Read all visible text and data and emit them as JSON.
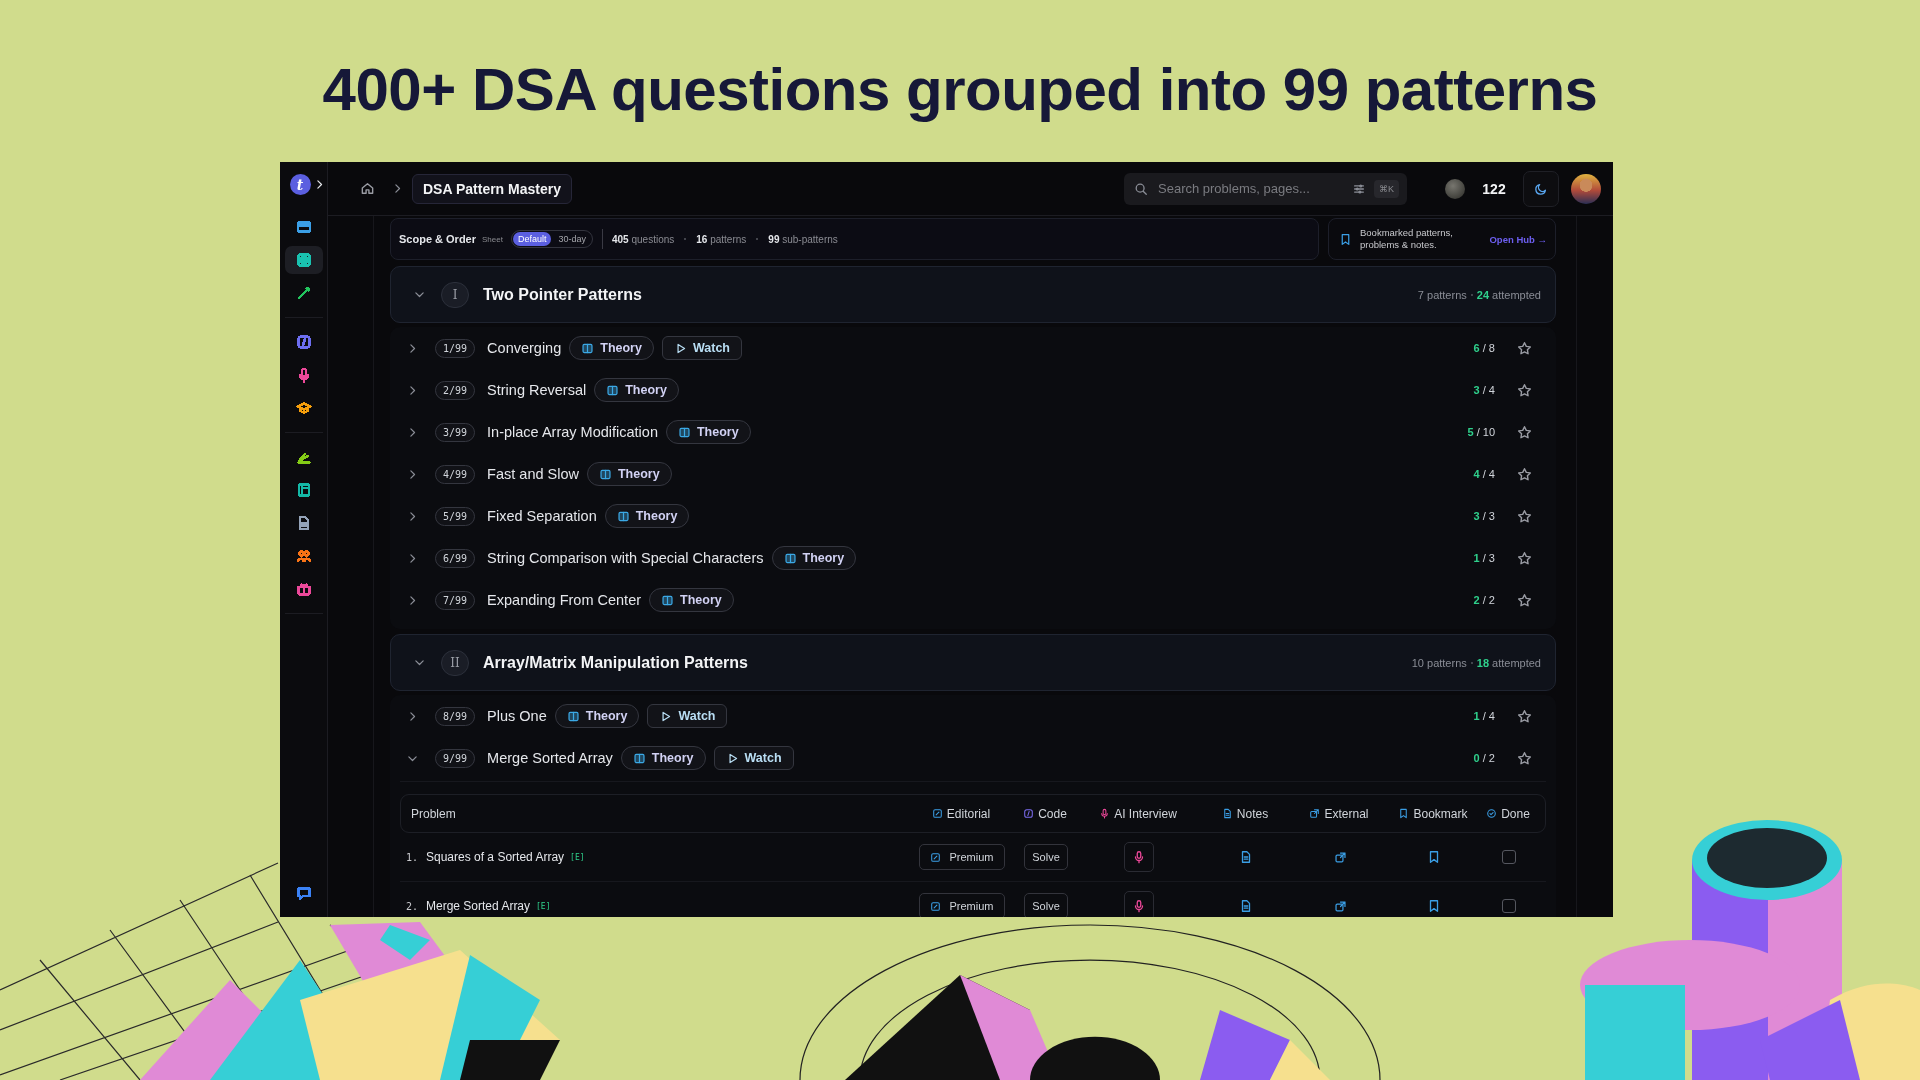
{
  "headline": "400+ DSA questions grouped into 99 patterns",
  "sidebar": {
    "logo": "t",
    "sections": [
      {
        "items": [
          {
            "kind": "card",
            "color": "#3b9fe6",
            "selected": false
          },
          {
            "kind": "grid",
            "color": "#19c2b0",
            "selected": true
          },
          {
            "kind": "pen",
            "color": "#22c55e",
            "selected": false
          }
        ]
      },
      {
        "items": [
          {
            "kind": "code",
            "color": "#6d6ef0",
            "selected": false
          },
          {
            "kind": "mic",
            "color": "#ec4899",
            "selected": false
          },
          {
            "kind": "cap",
            "color": "#f59e0b",
            "selected": false
          }
        ]
      },
      {
        "items": [
          {
            "kind": "chart",
            "color": "#84cc16",
            "selected": false
          },
          {
            "kind": "book",
            "color": "#14b8a6",
            "selected": false
          },
          {
            "kind": "doc",
            "color": "#94a3b8",
            "selected": false
          },
          {
            "kind": "people",
            "color": "#f97316",
            "selected": false
          },
          {
            "kind": "gift",
            "color": "#ec4899",
            "selected": false
          }
        ]
      }
    ],
    "footer": {
      "kind": "chat",
      "color": "#3b82f6",
      "selected": false
    }
  },
  "topbar": {
    "breadcrumb": "DSA Pattern Mastery",
    "search": {
      "placeholder": "Search problems, pages...",
      "shortcut": "⌘K"
    },
    "coins": "122"
  },
  "scope": {
    "title": "Scope & Order",
    "sheet_label": "Sheet",
    "options": [
      {
        "label": "Default",
        "selected": true
      },
      {
        "label": "30-day",
        "selected": false
      }
    ],
    "stats": [
      "**405** questions",
      "**16** patterns",
      "**99** sub-patterns"
    ]
  },
  "hub": {
    "text": "Bookmarked patterns, problems & notes.",
    "link": "Open Hub →"
  },
  "groups": [
    {
      "numeral": "I",
      "title": "Two Pointer Patterns",
      "expanded": true,
      "patterns_count": "7 patterns",
      "attempted": "**24** attempted",
      "patterns": [
        {
          "index": "1/99",
          "title": "Converging",
          "expanded": false,
          "links": [
            {
              "kind": "theory",
              "label": "Theory"
            },
            {
              "kind": "watch",
              "label": "Watch"
            }
          ],
          "progress": "**6** / 8",
          "starred": false
        },
        {
          "index": "2/99",
          "title": "String Reversal",
          "expanded": false,
          "links": [
            {
              "kind": "theory",
              "label": "Theory"
            }
          ],
          "progress": "**3** / 4",
          "starred": false
        },
        {
          "index": "3/99",
          "title": "In-place Array Modification",
          "expanded": false,
          "links": [
            {
              "kind": "theory",
              "label": "Theory"
            }
          ],
          "progress": "**5** / 10",
          "starred": false
        },
        {
          "index": "4/99",
          "title": "Fast and Slow",
          "expanded": false,
          "links": [
            {
              "kind": "theory",
              "label": "Theory"
            }
          ],
          "progress": "**4** / 4",
          "starred": false
        },
        {
          "index": "5/99",
          "title": "Fixed Separation",
          "expanded": false,
          "links": [
            {
              "kind": "theory",
              "label": "Theory"
            }
          ],
          "progress": "**3** / 3",
          "starred": false
        },
        {
          "index": "6/99",
          "title": "String Comparison with Special Characters",
          "expanded": false,
          "links": [
            {
              "kind": "theory",
              "label": "Theory"
            }
          ],
          "progress": "**1** / 3",
          "starred": false
        },
        {
          "index": "7/99",
          "title": "Expanding From Center",
          "expanded": false,
          "links": [
            {
              "kind": "theory",
              "label": "Theory"
            }
          ],
          "progress": "**2** / 2",
          "starred": false
        }
      ]
    },
    {
      "numeral": "II",
      "title": "Array/Matrix Manipulation Patterns",
      "expanded": true,
      "patterns_count": "10 patterns",
      "attempted": "**18** attempted",
      "patterns": [
        {
          "index": "8/99",
          "title": "Plus One",
          "expanded": false,
          "links": [
            {
              "kind": "theory",
              "label": "Theory"
            },
            {
              "kind": "watch",
              "label": "Watch"
            }
          ],
          "progress": "**1** / 4",
          "starred": false
        },
        {
          "index": "9/99",
          "title": "Merge Sorted Array",
          "expanded": true,
          "links": [
            {
              "kind": "theory",
              "label": "Theory"
            },
            {
              "kind": "watch",
              "label": "Watch"
            }
          ],
          "progress": "**0** / 2",
          "starred": false,
          "table": {
            "columns": [
              {
                "kind": "problem",
                "label": "Problem"
              },
              {
                "kind": "editorial",
                "label": "Editorial"
              },
              {
                "kind": "code",
                "label": "Code"
              },
              {
                "kind": "interview",
                "label": "AI Interview"
              },
              {
                "kind": "notes",
                "label": "Notes"
              },
              {
                "kind": "external",
                "label": "External"
              },
              {
                "kind": "bookmark",
                "label": "Bookmark"
              },
              {
                "kind": "done",
                "label": "Done"
              }
            ],
            "rows": [
              {
                "number": "1.",
                "title": "Squares of a Sorted Array",
                "difficulty": "[E]",
                "editorial": "Premium",
                "code": "Solve",
                "bookmarked": false,
                "done": false
              },
              {
                "number": "2.",
                "title": "Merge Sorted Array",
                "difficulty": "[E]",
                "editorial": "Premium",
                "code": "Solve",
                "bookmarked": false,
                "done": false
              }
            ]
          }
        }
      ]
    }
  ]
}
